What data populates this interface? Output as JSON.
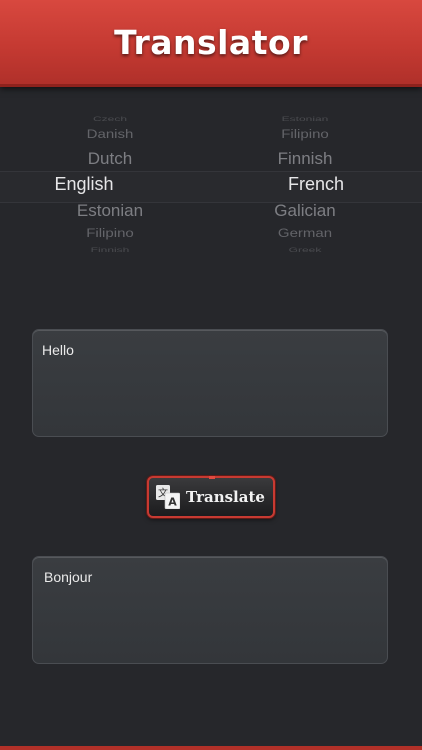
{
  "header": {
    "title": "Translator"
  },
  "picker": {
    "source_languages": [
      "Czech",
      "Danish",
      "Dutch",
      "English",
      "Estonian",
      "Filipino",
      "Finnish"
    ],
    "target_languages": [
      "Estonian",
      "Filipino",
      "Finnish",
      "French",
      "Galician",
      "German",
      "Greek"
    ],
    "selected_source": "English",
    "selected_target": "French"
  },
  "input": {
    "text": "Hello"
  },
  "translate_button": {
    "label": "Translate",
    "icon": "translate-icon"
  },
  "output": {
    "text": "Bonjour"
  },
  "colors": {
    "accent": "#c53a32",
    "background": "#26272b"
  }
}
